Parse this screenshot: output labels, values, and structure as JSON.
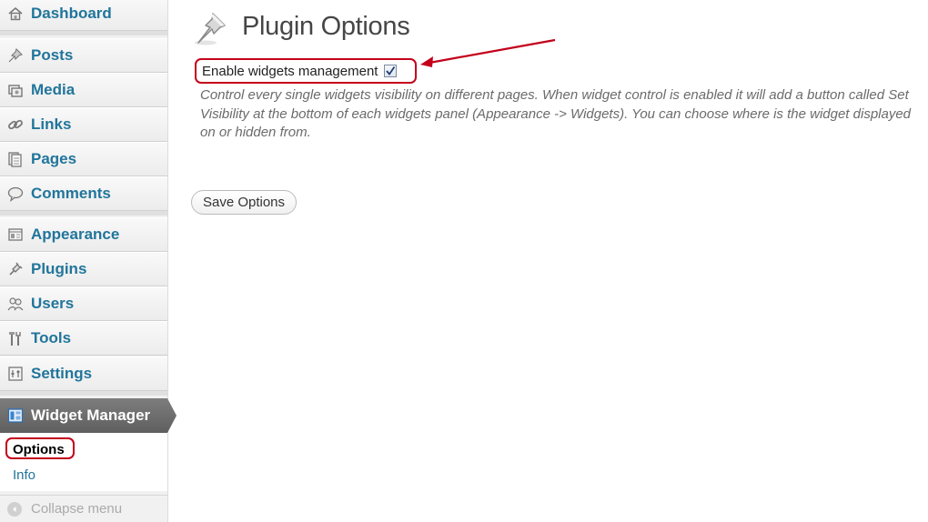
{
  "sidebar": {
    "items": [
      {
        "id": "dashboard",
        "label": "Dashboard",
        "icon": "house-icon"
      },
      {
        "id": "posts",
        "label": "Posts",
        "icon": "pushpin-icon"
      },
      {
        "id": "media",
        "label": "Media",
        "icon": "media-icon"
      },
      {
        "id": "links",
        "label": "Links",
        "icon": "chain-link-icon"
      },
      {
        "id": "pages",
        "label": "Pages",
        "icon": "pages-icon"
      },
      {
        "id": "comments",
        "label": "Comments",
        "icon": "speech-bubble-icon"
      },
      {
        "id": "appearance",
        "label": "Appearance",
        "icon": "appearance-icon"
      },
      {
        "id": "plugins",
        "label": "Plugins",
        "icon": "plug-icon"
      },
      {
        "id": "users",
        "label": "Users",
        "icon": "users-icon"
      },
      {
        "id": "tools",
        "label": "Tools",
        "icon": "tools-icon"
      },
      {
        "id": "settings",
        "label": "Settings",
        "icon": "settings-icon"
      }
    ],
    "active": {
      "label": "Widget Manager",
      "icon": "widget-manager-icon"
    },
    "submenu": [
      {
        "id": "options",
        "label": "Options"
      },
      {
        "id": "info",
        "label": "Info"
      }
    ],
    "collapse_label": "Collapse menu"
  },
  "main": {
    "title": "Plugin Options",
    "checkbox_label": "Enable widgets management",
    "checkbox_checked": true,
    "description": "Control every single widgets visibility on different pages. When widget control is enabled it will add a button called Set Visibility at the bottom of each widgets panel (Appearance -> Widgets). You can choose where is the widget displayed on or hidden from.",
    "save_label": "Save Options"
  },
  "colors": {
    "link": "#21759b",
    "active_menu": "#6d6d6d",
    "highlight": "#c4001a"
  }
}
